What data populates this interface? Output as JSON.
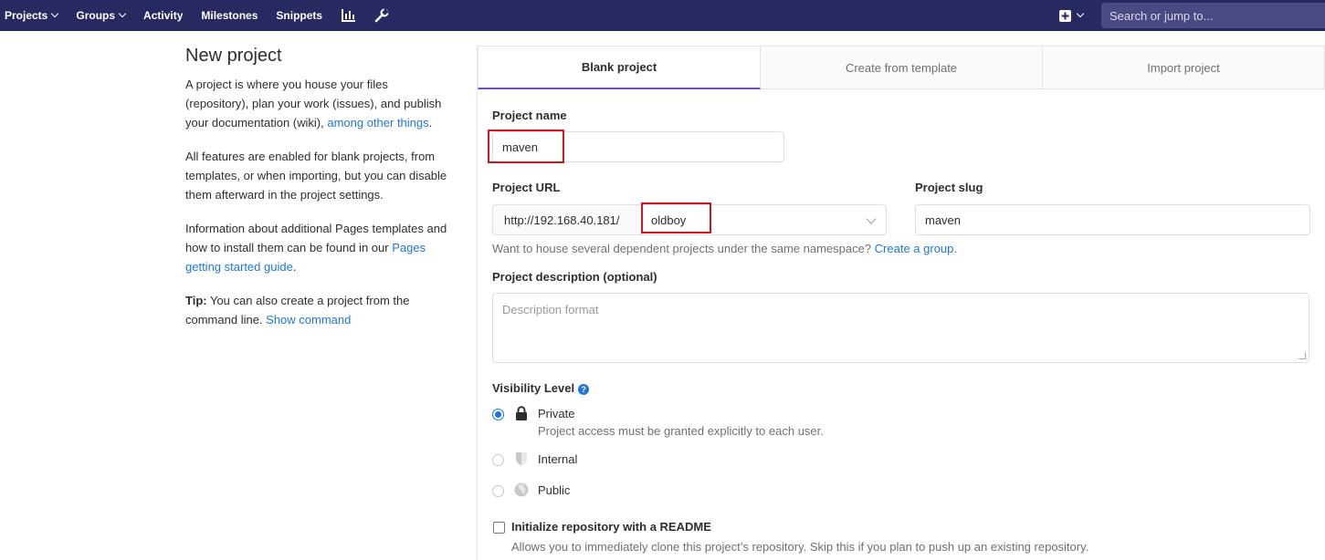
{
  "nav": {
    "projects": "Projects",
    "groups": "Groups",
    "activity": "Activity",
    "milestones": "Milestones",
    "snippets": "Snippets",
    "chart_icon": "chart-icon",
    "wrench_icon": "wrench-icon",
    "new_icon": "plus-square-icon",
    "search_placeholder": "Search or jump to..."
  },
  "sidebar": {
    "title": "New project",
    "intro_text": "A project is where you house your files (repository), plan your work (issues), and publish your documentation (wiki), ",
    "intro_link": "among other things",
    "intro_end": ".",
    "features_text": "All features are enabled for blank projects, from templates, or when importing, but you can disable them afterward in the project settings.",
    "pages_text": "Information about additional Pages templates and how to install them can be found in our ",
    "pages_link": "Pages getting started guide",
    "pages_end": ".",
    "tip_label": "Tip:",
    "tip_text": " You can also create a project from the command line. ",
    "tip_link": "Show command"
  },
  "tabs": [
    {
      "label": "Blank project",
      "active": true
    },
    {
      "label": "Create from template",
      "active": false
    },
    {
      "label": "Import project",
      "active": false
    }
  ],
  "form": {
    "project_name_label": "Project name",
    "project_name_value": "maven",
    "project_url_label": "Project URL",
    "url_prefix": "http://192.168.40.181/",
    "namespace_value": "oldboy",
    "project_slug_label": "Project slug",
    "project_slug_value": "maven",
    "namespace_help": "Want to house several dependent projects under the same namespace? ",
    "namespace_help_link": "Create a group.",
    "description_label": "Project description (optional)",
    "description_placeholder": "Description format",
    "visibility_label": "Visibility Level",
    "visibility_options": [
      {
        "label": "Private",
        "description": "Project access must be granted explicitly to each user.",
        "selected": true,
        "icon": "lock-icon"
      },
      {
        "label": "Internal",
        "description": "",
        "selected": false,
        "icon": "shield-icon"
      },
      {
        "label": "Public",
        "description": "",
        "selected": false,
        "icon": "globe-icon"
      }
    ],
    "readme_label": "Initialize repository with a README",
    "readme_help": "Allows you to immediately clone this project’s repository. Skip this if you plan to push up an existing repository.",
    "readme_checked": false
  },
  "colors": {
    "navbar": "#292961",
    "accent": "#6b4fbb",
    "link": "#1f78d1",
    "highlight_box": "#d3141b"
  }
}
